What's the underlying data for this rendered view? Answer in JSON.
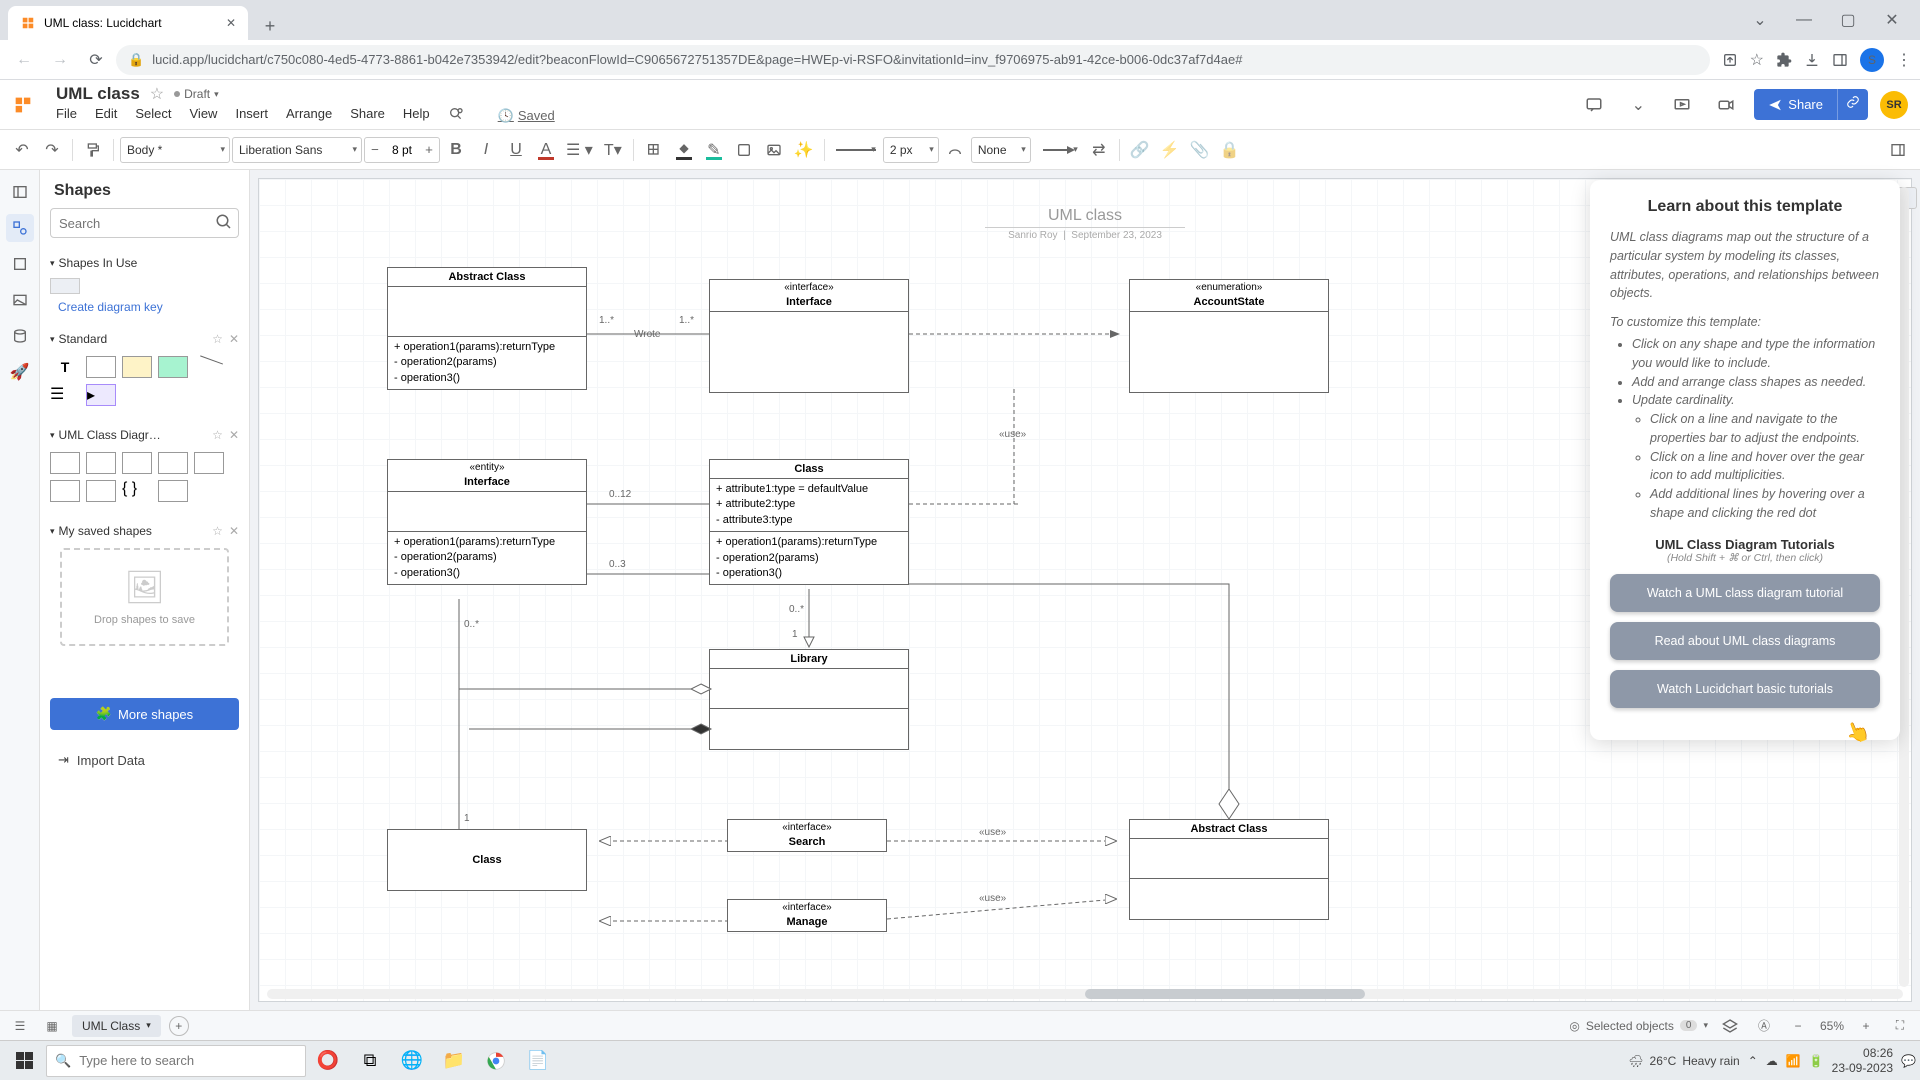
{
  "browser": {
    "tab_title": "UML class: Lucidchart",
    "url": "lucid.app/lucidchart/c750c080-4ed5-4773-8861-b042e7353942/edit?beaconFlowId=C9065672751357DE&page=HWEp-vi-RSFO&invitationId=inv_f9706975-ab91-42ce-b006-0dc37af7d4ae#"
  },
  "doc": {
    "title": "UML class",
    "status_label": "Draft",
    "saved_label": "Saved",
    "menu": [
      "File",
      "Edit",
      "Select",
      "View",
      "Insert",
      "Arrange",
      "Share",
      "Help"
    ]
  },
  "header_actions": {
    "share_label": "Share",
    "user_initials": "SR",
    "avatar_letter": "S"
  },
  "toolbar": {
    "font_family_style": "Body *",
    "font_name": "Liberation Sans",
    "font_size": "8 pt",
    "line_width": "2 px",
    "line_style": "None"
  },
  "shapes_panel": {
    "title": "Shapes",
    "search_placeholder": "Search",
    "sections": {
      "in_use": "Shapes In Use",
      "diagram_key": "Create diagram key",
      "standard": "Standard",
      "uml_class": "UML Class Diagr…",
      "saved": "My saved shapes"
    },
    "drop_hint": "Drop shapes to save",
    "more_shapes": "More shapes",
    "import_data": "Import Data"
  },
  "canvas": {
    "title": "UML class",
    "author": "Sanrio Roy",
    "date": "September 23, 2023",
    "boxes": {
      "abstract1": {
        "title": "Abstract Class",
        "ops": "+ operation1(params):returnType\n- operation2(params)\n- operation3()"
      },
      "interface1": {
        "stereo": "«interface»",
        "title": "Interface"
      },
      "enum": {
        "stereo": "«enumeration»",
        "title": "AccountState"
      },
      "entity": {
        "stereo": "«entity»",
        "title": "Interface",
        "ops": "+ operation1(params):returnType\n- operation2(params)\n- operation3()"
      },
      "class1": {
        "title": "Class",
        "attrs": "+ attribute1:type = defaultValue\n+ attribute2:type\n- attribute3:type",
        "ops": "+ operation1(params):returnType\n- operation2(params)\n- operation3()"
      },
      "library": {
        "title": "Library"
      },
      "class2": {
        "title": "Class"
      },
      "search": {
        "stereo": "«interface»",
        "title": "Search"
      },
      "manage": {
        "stereo": "«interface»",
        "title": "Manage"
      },
      "abstract2": {
        "title": "Abstract Class"
      }
    },
    "labels": {
      "m1": "1..*",
      "m2": "1..*",
      "wrote": "Wrote",
      "use1": "«use»",
      "m3": "0..12",
      "m4": "0..3",
      "m5": "0..*",
      "m6": "0..*",
      "m7": "1",
      "m8": "1",
      "use2": "«use»",
      "use3": "«use»"
    }
  },
  "info_panel": {
    "title": "Learn about this template",
    "description": "UML class diagrams map out the structure of a particular system by modeling its classes, attributes, operations, and relationships between objects.",
    "customize_label": "To customize this template:",
    "bullets": [
      "Click on any shape and type the information you would like to include.",
      "Add and arrange class shapes as needed.",
      "Update cardinality."
    ],
    "sub_bullets": [
      "Click on a line and navigate to the properties bar to adjust the endpoints.",
      "Click on a line and hover over the gear icon to add multiplicities.",
      "Add additional lines by hovering over a shape and clicking the red dot"
    ],
    "tutorials_title": "UML Class Diagram Tutorials",
    "tutorials_hint": "(Hold Shift + ⌘ or Ctrl, then click)",
    "buttons": [
      "Watch a UML class diagram tutorial",
      "Read about UML class diagrams",
      "Watch Lucidchart basic tutorials"
    ]
  },
  "bottom_bar": {
    "page_tab": "UML Class",
    "selected_label": "Selected objects",
    "selected_count": "0",
    "zoom": "65%"
  },
  "taskbar": {
    "search_placeholder": "Type here to search",
    "weather_temp": "26°C",
    "weather_desc": "Heavy rain",
    "time": "08:26",
    "date": "23-09-2023"
  }
}
